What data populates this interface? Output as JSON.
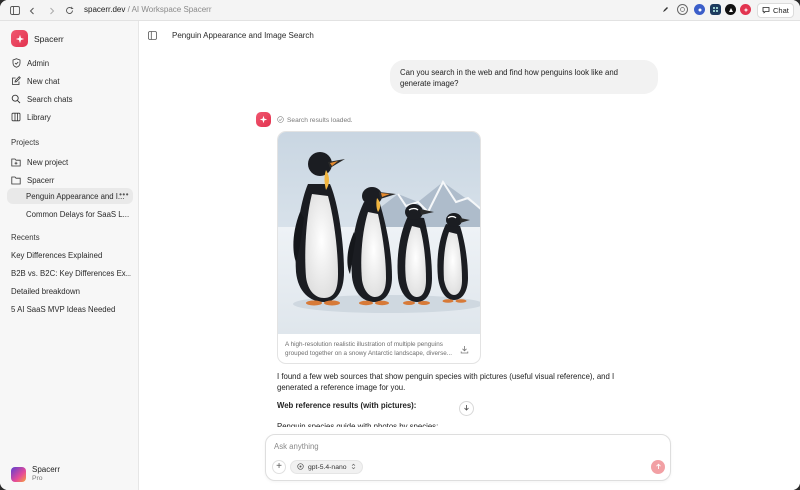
{
  "browser": {
    "domain": "spacerr.dev",
    "separator": " / ",
    "page_title": "AI Workspace Spacerr",
    "chat_button_label": "Chat"
  },
  "sidebar": {
    "brand": "Spacerr",
    "nav": [
      {
        "label": "Admin",
        "icon": "shield-icon"
      },
      {
        "label": "New chat",
        "icon": "compose-icon"
      },
      {
        "label": "Search chats",
        "icon": "search-icon"
      },
      {
        "label": "Library",
        "icon": "library-icon"
      }
    ],
    "projects_label": "Projects",
    "projects": [
      {
        "label": "New project",
        "icon": "folder-plus-icon"
      },
      {
        "label": "Spacerr",
        "icon": "folder-icon"
      }
    ],
    "project_chats": [
      {
        "label": "Penguin Appearance and I..."
      },
      {
        "label": "Common Delays for SaaS L..."
      }
    ],
    "recents_label": "Recents",
    "recents": [
      {
        "label": "Key Differences Explained"
      },
      {
        "label": "B2B vs. B2C: Key Differences Ex..."
      },
      {
        "label": "Detailed breakdown"
      },
      {
        "label": "5 AI SaaS MVP Ideas Needed"
      }
    ],
    "user": {
      "name": "Spacerr",
      "plan": "Pro"
    }
  },
  "main": {
    "title": "Penguin Appearance and Image Search",
    "user_message": "Can you search in the web and find how penguins look like and generate image?",
    "status": "Search results loaded.",
    "image_caption": "A high-resolution realistic illustration of multiple penguins grouped together on a snowy Antarctic landscape, diverse...",
    "reply_intro": "I found a few web sources that show penguin species with pictures (useful visual reference), and I generated a reference image for you.",
    "reply_heading": "Web reference results (with pictures):",
    "reply_sub": "Penguin species guide with photos by species:"
  },
  "composer": {
    "placeholder": "Ask anything",
    "model": "gpt-5.4-nano"
  },
  "colors": {
    "accent": "#e8405a",
    "send_disabled": "#f2a0a4"
  }
}
